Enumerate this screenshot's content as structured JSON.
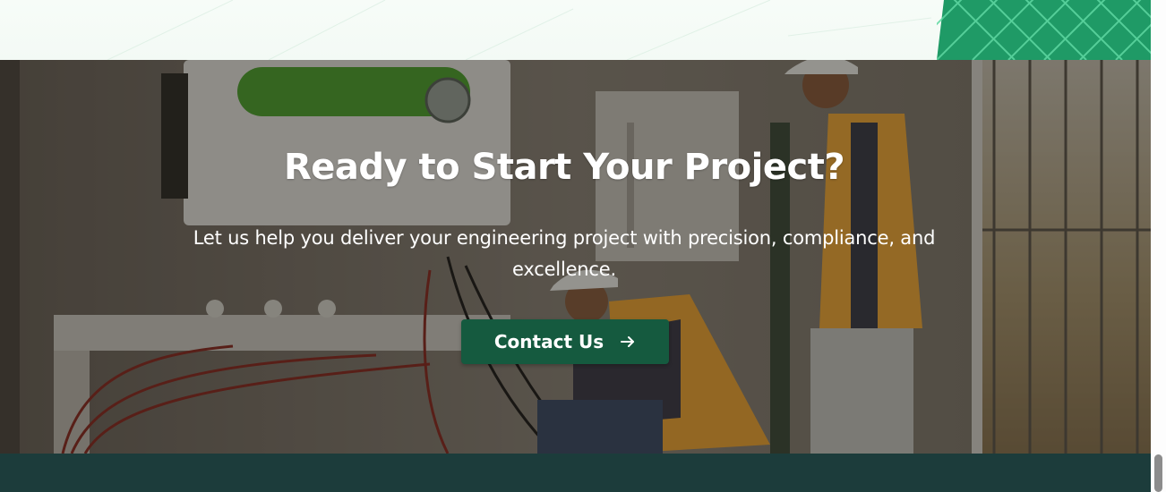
{
  "cta": {
    "title": "Ready to Start Your Project?",
    "subtitle": "Let us help you deliver your engineering project with precision, compliance, and excellence.",
    "button_label": "Contact Us",
    "button_icon": "arrow-right-icon"
  },
  "colors": {
    "brand_green": "#155a3f",
    "footer_bg": "#1c3c3b",
    "pattern_green": "#1faa6e",
    "text_on_dark": "#ffffff"
  }
}
